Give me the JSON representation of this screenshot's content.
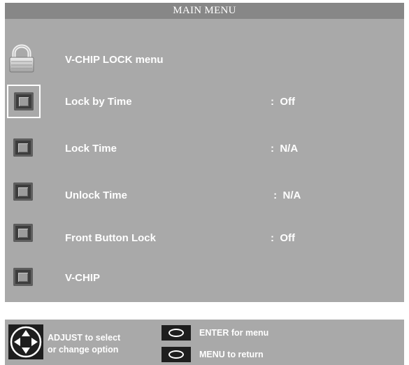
{
  "title": "MAIN MENU",
  "menu": {
    "items": [
      {
        "label": "V-CHIP LOCK menu",
        "value": "",
        "icon": "padlock-icon"
      },
      {
        "label": "Lock by Time",
        "value": ":  Off",
        "icon": "button-icon",
        "selected": true
      },
      {
        "label": "Lock Time",
        "value": ":  N/A",
        "icon": "button-icon"
      },
      {
        "label": "Unlock Time",
        "value": " :  N/A",
        "icon": "button-icon"
      },
      {
        "label": "Front Button Lock",
        "value": ":  Off",
        "icon": "button-icon"
      },
      {
        "label": "V-CHIP",
        "value": "",
        "icon": "button-icon"
      }
    ]
  },
  "footer": {
    "adjust_line1": "ADJUST to select",
    "adjust_line2": "or  change option",
    "enter": "ENTER for menu",
    "menu_return": "MENU to return",
    "dpad_icon": "dpad-icon",
    "enter_icon": "oval-button-icon",
    "menu_icon": "oval-button-icon"
  },
  "colors": {
    "panel": "#a9a9a9",
    "title_bar": "#878787",
    "text": "#ffffff"
  }
}
